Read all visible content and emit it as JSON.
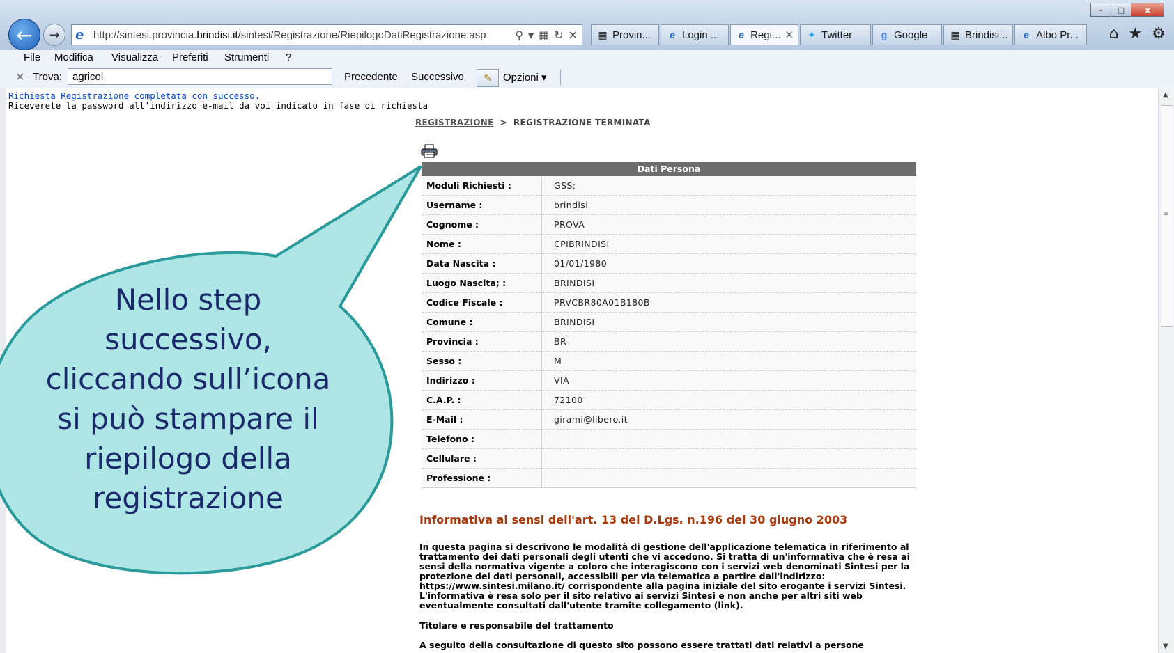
{
  "browser": {
    "window_controls": [
      "–",
      "□",
      "x"
    ],
    "url_prefix": "http://sintesi.provincia.",
    "url_domain": "brindisi.it",
    "url_suffix": "/sintesi/Registrazione/RiepilogoDatiRegistrazione.asp",
    "tabs": [
      {
        "label": "Provin...",
        "icon": "page-icon"
      },
      {
        "label": "Login ...",
        "icon": "ie-icon"
      },
      {
        "label": "Regi...",
        "icon": "ie-icon",
        "active": true
      },
      {
        "label": "Twitter",
        "icon": "twitter-icon"
      },
      {
        "label": "Google",
        "icon": "google-icon"
      },
      {
        "label": "Brindisi...",
        "icon": "page-icon"
      },
      {
        "label": "Albo Pr...",
        "icon": "ie-icon"
      }
    ],
    "menu": [
      "File",
      "Modifica",
      "Visualizza",
      "Preferiti",
      "Strumenti",
      "?"
    ],
    "find": {
      "label": "Trova:",
      "value": "agricol",
      "prev": "Precedente",
      "next": "Successivo",
      "options": "Opzioni"
    }
  },
  "page": {
    "status_link": "Richiesta Registrazione completata con successo.",
    "status_note": "Riceverete la password all'indirizzo e-mail da voi indicato in fase di richiesta",
    "breadcrumb": {
      "link": "REGISTRAZIONE",
      "separator": ">",
      "current": "REGISTRAZIONE TERMINATA"
    },
    "table": {
      "header": "Dati Persona",
      "rows": [
        {
          "label": "Moduli Richiesti :",
          "value": "GSS;"
        },
        {
          "label": "Username :",
          "value": "brindisi"
        },
        {
          "label": "Cognome :",
          "value": "PROVA"
        },
        {
          "label": "Nome :",
          "value": "CPIBRINDISI"
        },
        {
          "label": "Data Nascita :",
          "value": "01/01/1980"
        },
        {
          "label": "Luogo Nascita; :",
          "value": "BRINDISI"
        },
        {
          "label": "Codice Fiscale :",
          "value": "PRVCBR80A01B180B"
        },
        {
          "label": "Comune :",
          "value": "BRINDISI"
        },
        {
          "label": "Provincia :",
          "value": "BR"
        },
        {
          "label": "Sesso :",
          "value": "M"
        },
        {
          "label": "Indirizzo :",
          "value": "VIA"
        },
        {
          "label": "C.A.P. :",
          "value": "72100"
        },
        {
          "label": "E-Mail :",
          "value": "girami@libero.it"
        },
        {
          "label": "Telefono :",
          "value": ""
        },
        {
          "label": "Cellulare :",
          "value": ""
        },
        {
          "label": "Professione :",
          "value": ""
        }
      ]
    },
    "info_title": "Informativa ai sensi dell'art. 13 del D.Lgs. n.196 del 30 giugno 2003",
    "info_body": "In questa pagina si descrivono le modalità di gestione dell'applicazione telematica in riferimento al trattamento dei dati personali degli utenti che vi accedono. Si tratta di un'informativa che è resa ai sensi della normativa vigente a coloro che interagiscono con i servizi web denominati Sintesi per la protezione dei dati personali, accessibili per via telematica a partire dall'indirizzo: https://www.sintesi.milano.it/ corrispondente alla pagina iniziale del sito erogante i servizi Sintesi. L'informativa è resa solo per il sito relativo ai servizi Sintesi e non anche per altri siti web eventualmente consultati dall'utente tramite collegamento (link).",
    "info_subtitle": "Titolare e responsabile del trattamento",
    "info_tail": "A seguito della consultazione di questo sito possono essere trattati dati relativi a persone"
  },
  "callout": {
    "text": "Nello step successivo, cliccando sull’icona si può stampare il riepilogo della registrazione",
    "fill": "#aee6e6",
    "stroke": "#2a9a9a",
    "text_color": "#1b2a6b"
  }
}
